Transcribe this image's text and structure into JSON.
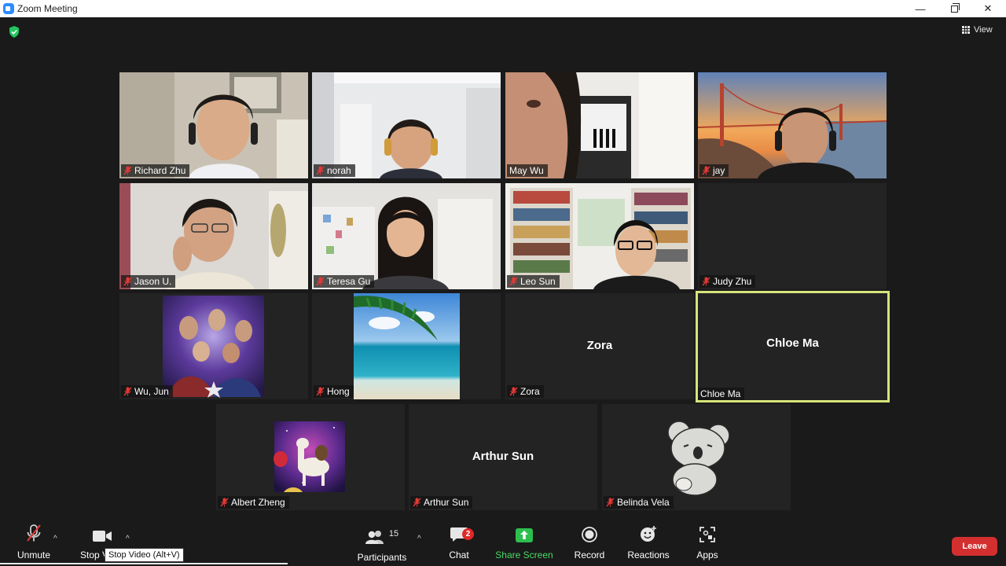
{
  "window": {
    "title": "Zoom Meeting",
    "controls": {
      "minimize": "—",
      "close": "✕"
    }
  },
  "header": {
    "view_label": "View"
  },
  "tiles": [
    {
      "name": "Richard Zhu",
      "muted": true
    },
    {
      "name": "norah",
      "muted": true
    },
    {
      "name": "May Wu",
      "muted": false
    },
    {
      "name": "jay",
      "muted": true
    },
    {
      "name": "Jason U.",
      "muted": true
    },
    {
      "name": "Teresa Gu",
      "muted": true
    },
    {
      "name": "Leo Sun",
      "muted": true
    },
    {
      "name": "Judy Zhu",
      "muted": true
    },
    {
      "name": "Wu, Jun",
      "muted": true
    },
    {
      "name": "Hong",
      "muted": true
    },
    {
      "name": "Zora",
      "muted": true,
      "center_name": "Zora"
    },
    {
      "name": "Chloe Ma",
      "muted": false,
      "center_name": "Chloe Ma",
      "active_speaker": true
    },
    {
      "name": "Albert Zheng",
      "muted": true
    },
    {
      "name": "Arthur Sun",
      "muted": true,
      "center_name": "Arthur Sun"
    },
    {
      "name": "Belinda Vela",
      "muted": true
    }
  ],
  "toolbar": {
    "unmute_label": "Unmute",
    "stop_video_label": "Stop V",
    "participants_label": "Participants",
    "participants_count": "15",
    "chat_label": "Chat",
    "chat_badge": "2",
    "share_screen_label": "Share Screen",
    "record_label": "Record",
    "reactions_label": "Reactions",
    "apps_label": "Apps",
    "leave_label": "Leave",
    "tooltip": "Stop Video (Alt+V)",
    "caret": "^"
  },
  "colors": {
    "background": "#1a1a1a",
    "tile": "#232323",
    "active_speaker_border": "#d7e57a",
    "share_screen": "#2dbe4e",
    "leave": "#d32f2f",
    "badge": "#e02828",
    "mute_red": "#e53935"
  },
  "icons": {
    "security": "shield-check-icon",
    "view": "grid-icon",
    "mute": "microphone-muted-icon",
    "video": "video-camera-icon",
    "participants": "people-icon",
    "chat": "chat-bubble-icon",
    "share": "share-arrow-up-icon",
    "record": "record-circle-icon",
    "reactions": "smiley-plus-icon",
    "apps": "apps-icon"
  }
}
